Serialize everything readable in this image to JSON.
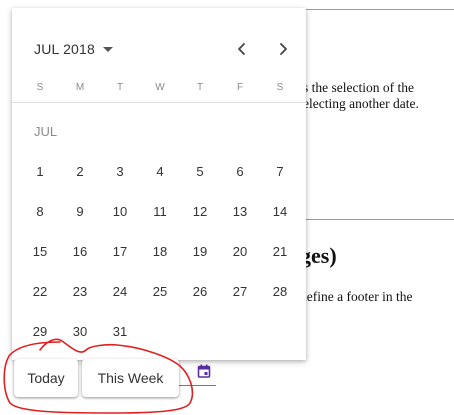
{
  "document": {
    "line1": "es the selection of the",
    "line2": "electing another date.",
    "heading": "ges)",
    "line3": "define a footer in the"
  },
  "datepicker": {
    "month_year": "JUL 2018",
    "prev_icon": "chevron-left-icon",
    "next_icon": "chevron-right-icon",
    "weekdays": [
      "S",
      "M",
      "T",
      "W",
      "T",
      "F",
      "S"
    ],
    "month_label": "JUL",
    "days": [
      "1",
      "2",
      "3",
      "4",
      "5",
      "6",
      "7",
      "8",
      "9",
      "10",
      "11",
      "12",
      "13",
      "14",
      "15",
      "16",
      "17",
      "18",
      "19",
      "20",
      "21",
      "22",
      "23",
      "24",
      "25",
      "26",
      "27",
      "28",
      "29",
      "30",
      "31"
    ]
  },
  "footer": {
    "today_label": "Today",
    "this_week_label": "This Week"
  },
  "colors": {
    "annotation": "#e02020",
    "calendar_icon": "#5b2da0"
  }
}
